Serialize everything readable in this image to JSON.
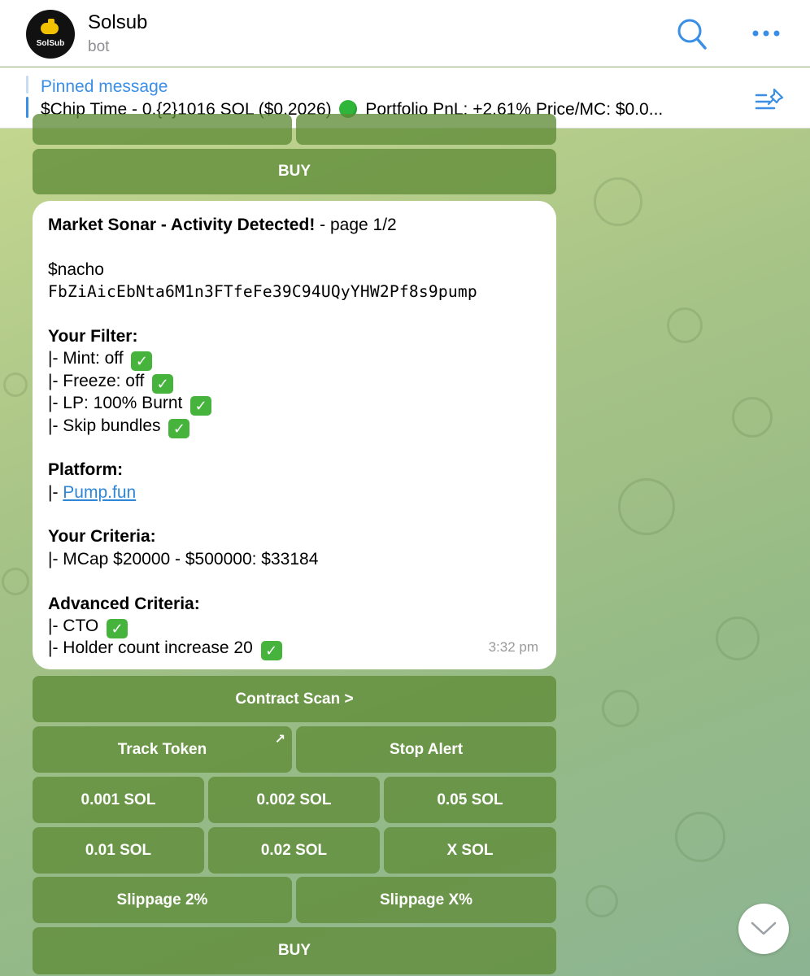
{
  "header": {
    "title": "Solsub",
    "subtitle": "bot",
    "avatar_text": "SolSub"
  },
  "pinned": {
    "title": "Pinned message",
    "text_part1": "$Chip Time - 0.{2}1016 SOL ($0.2026)",
    "text_part2": "Portfolio PnL: +2.61%  Price/MC: $0.0..."
  },
  "top_keyboard": {
    "buy_label": "BUY"
  },
  "message": {
    "title": "Market Sonar - Activity Detected!",
    "page": " - page 1/2",
    "ticker": "$nacho",
    "address": "FbZiAicEbNta6M1n3FTfeFe39C94UQyYHW2Pf8s9pump",
    "filter_heading": "Your Filter:",
    "filter_items": [
      "|- Mint: off",
      "|- Freeze: off",
      "|- LP: 100% Burnt",
      "|- Skip bundles"
    ],
    "platform_heading": "Platform:",
    "platform_prefix": "|- ",
    "platform_link": "Pump.fun",
    "criteria_heading": "Your Criteria:",
    "criteria_item": "|- MCap $20000 - $500000: $33184",
    "advanced_heading": "Advanced Criteria:",
    "advanced_items": [
      "|- CTO",
      "|- Holder count increase 20"
    ],
    "time": "3:32 pm",
    "check_glyph": "✓"
  },
  "keyboard": {
    "contract_scan": "Contract Scan >",
    "track_token": "Track Token",
    "track_arrow": "↗",
    "stop_alert": "Stop Alert",
    "sol_row1": [
      "0.001 SOL",
      "0.002 SOL",
      "0.05 SOL"
    ],
    "sol_row2": [
      "0.01 SOL",
      "0.02 SOL",
      "X SOL"
    ],
    "slippage_2": "Slippage 2%",
    "slippage_x": "Slippage X%",
    "buy": "BUY"
  },
  "colors": {
    "accent_blue": "#3a8ee6",
    "button_green": "#5f8c37",
    "check_green": "#46b43c"
  }
}
